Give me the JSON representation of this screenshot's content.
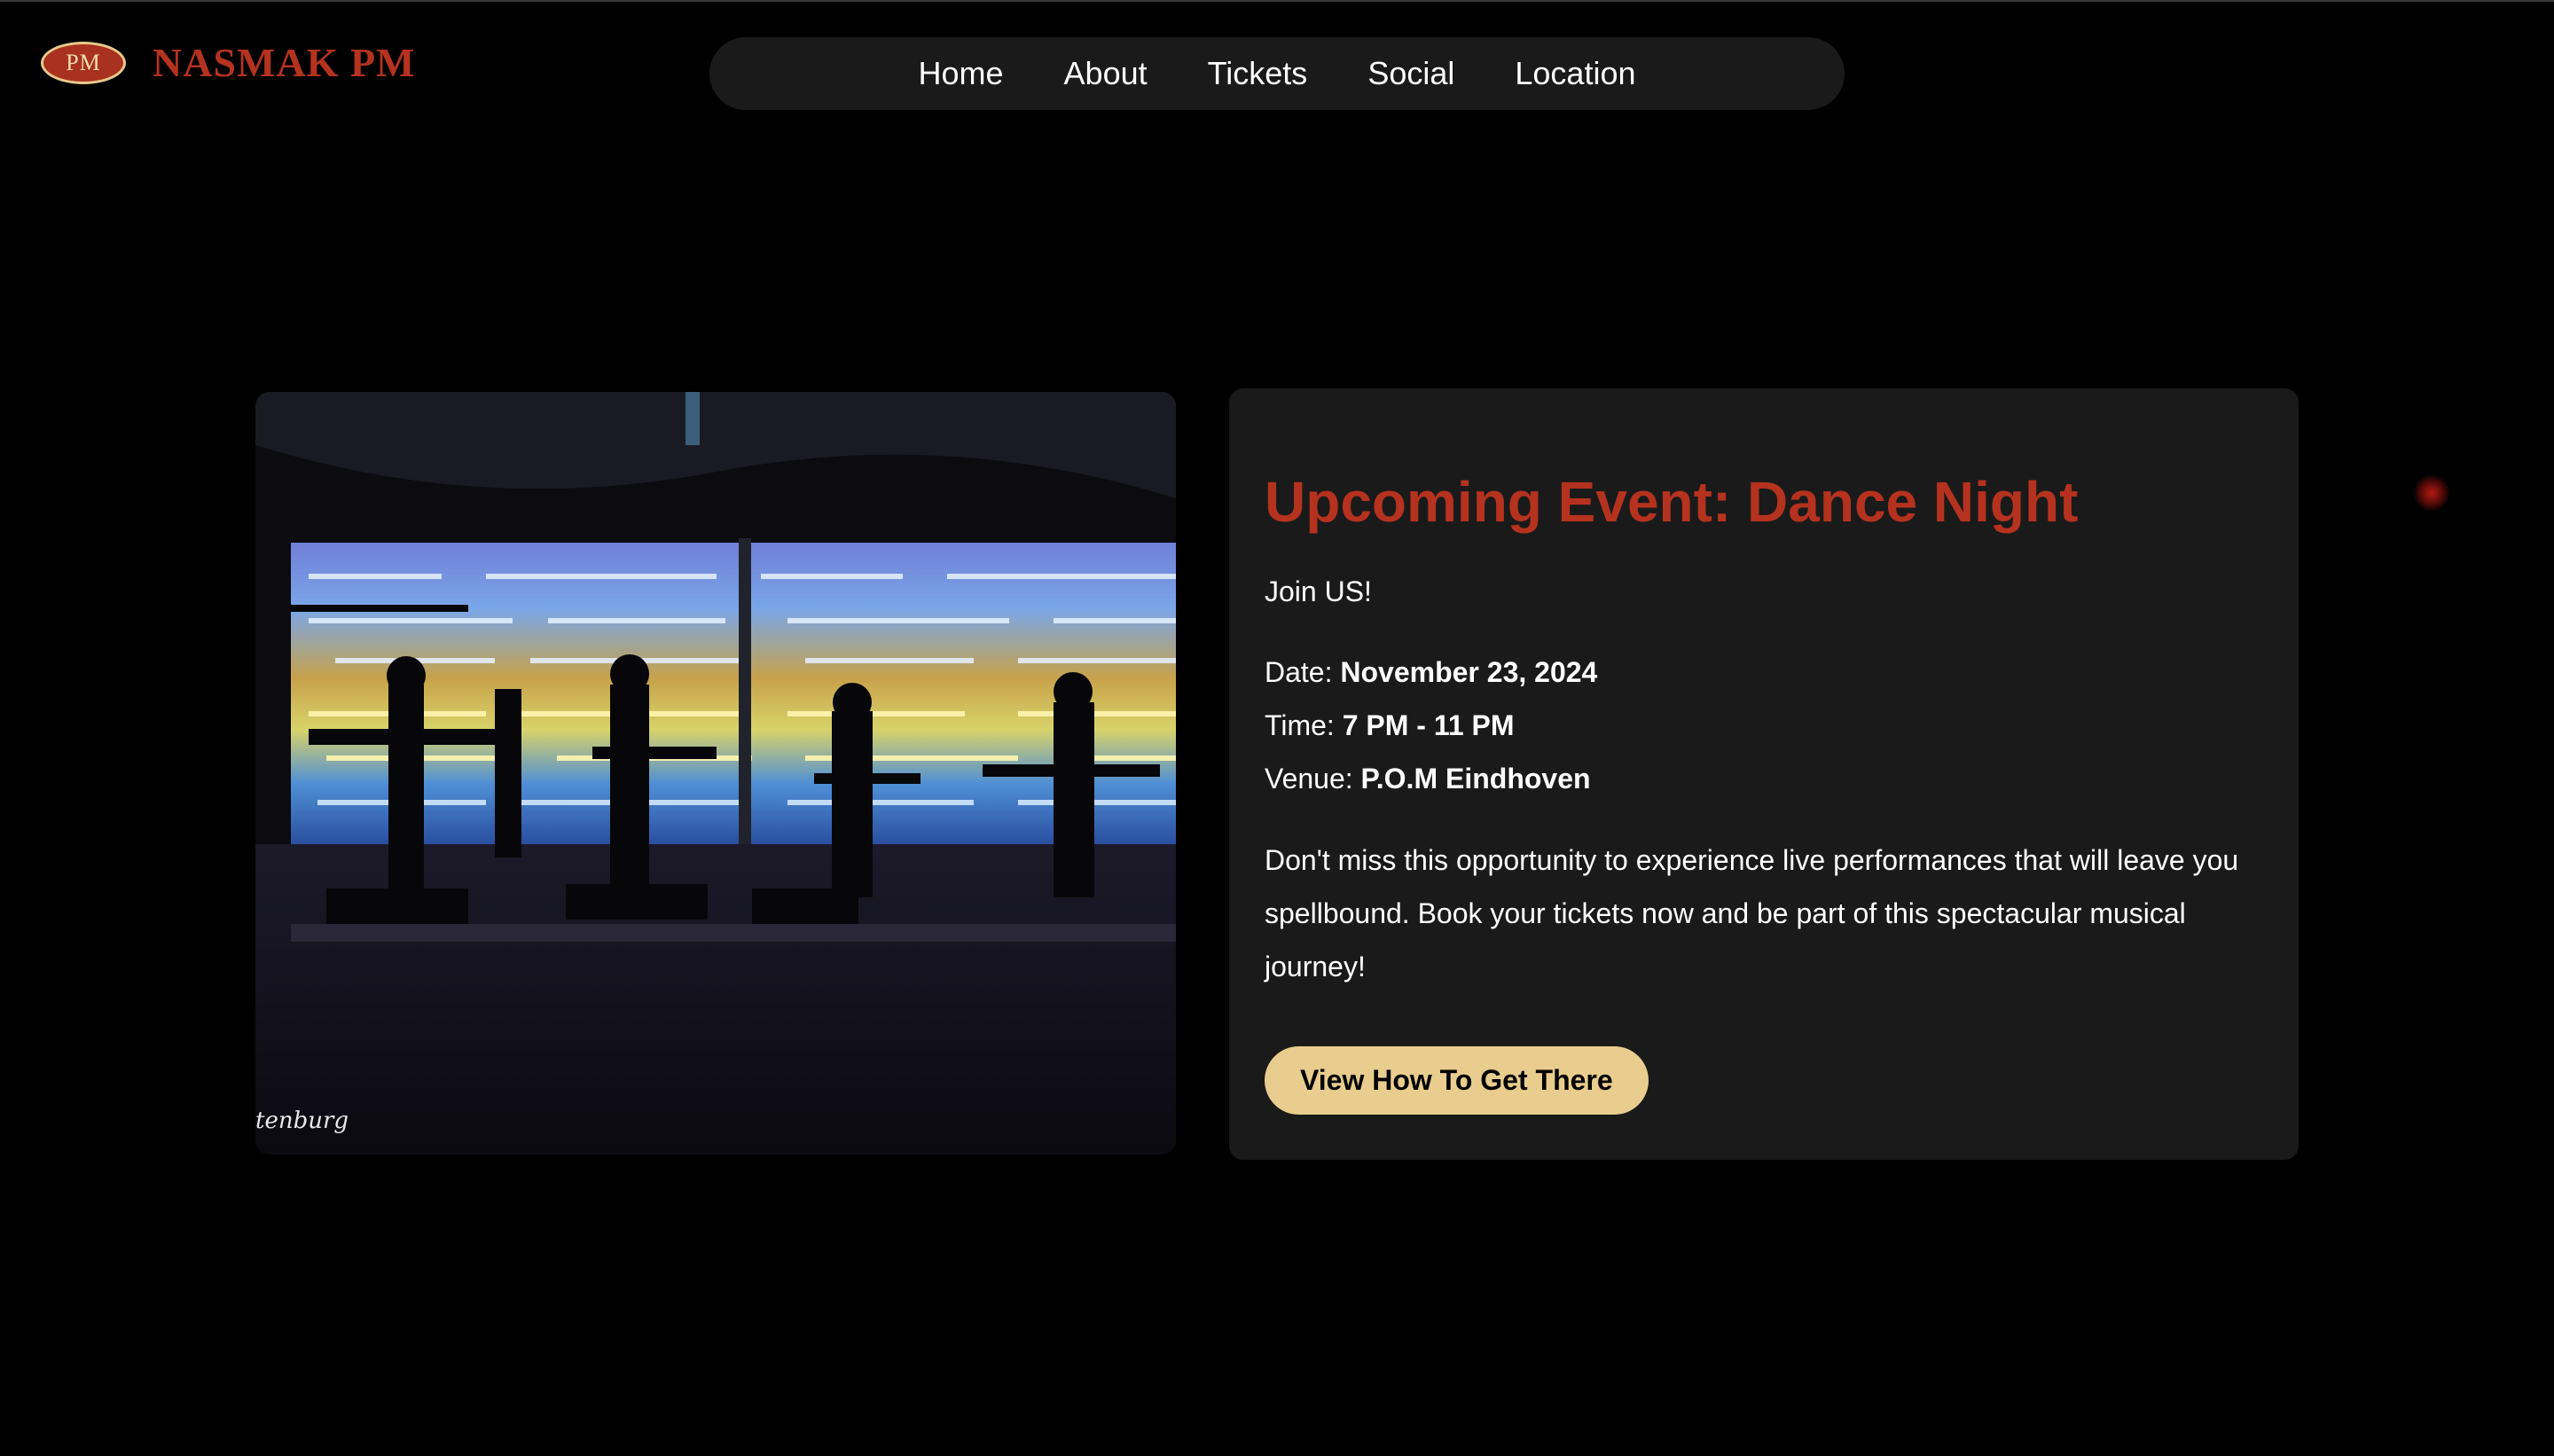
{
  "header": {
    "logo_badge_text": "PM",
    "brand_name": "NASMAK PM"
  },
  "nav": {
    "items": [
      {
        "label": "Home"
      },
      {
        "label": "About"
      },
      {
        "label": "Tickets"
      },
      {
        "label": "Social"
      },
      {
        "label": "Location"
      }
    ]
  },
  "event": {
    "image": {
      "signature_text": "tenburg"
    },
    "title": "Upcoming Event: Dance Night",
    "tagline": "Join US!",
    "date_label": "Date: ",
    "date_value": "November 23, 2024",
    "time_label": "Time: ",
    "time_value": "7 PM - 11 PM",
    "venue_label": "Venue: ",
    "venue_value": "P.O.M Eindhoven",
    "description": "Don't miss this opportunity to experience live performances that will leave you spellbound. Book your tickets now and be part of this spectacular musical journey!",
    "cta_label": "View How To Get There"
  },
  "colors": {
    "background": "#000000",
    "panel": "#1a1a1a",
    "accent_red": "#b5321f",
    "button_gold": "#e9cd8e"
  }
}
